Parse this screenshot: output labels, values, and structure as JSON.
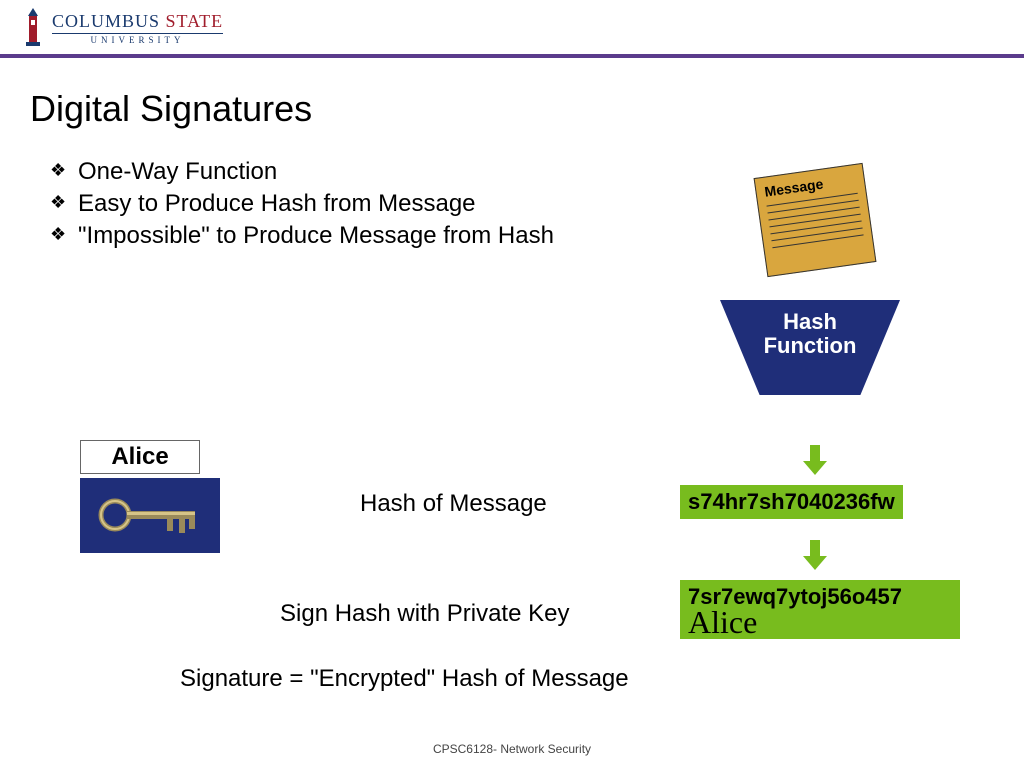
{
  "university": {
    "name_part1": "COLUMBUS",
    "name_part2": "STATE",
    "subline": "UNIVERSITY"
  },
  "slide": {
    "title": "Digital Signatures",
    "bullets": [
      "One-Way Function",
      "Easy to Produce Hash from Message",
      "\"Impossible\" to Produce Message from Hash"
    ]
  },
  "diagram": {
    "message_label": "Message",
    "hash_function_label": "Hash Function",
    "alice_label": "Alice",
    "hash_of_message_label": "Hash of Message",
    "sign_label": "Sign Hash with Private Key",
    "signature_label": "Signature = \"Encrypted\" Hash of Message",
    "hash_value": "s74hr7sh7040236fw",
    "signed_value": "7sr7ewq7ytoj56o457",
    "signature_name": "Alice"
  },
  "footer": "CPSC6128- Network Security",
  "colors": {
    "accent_purple": "#5b3b8c",
    "navy": "#1f2e79",
    "green": "#78bc1e",
    "note": "#d9a63e"
  }
}
